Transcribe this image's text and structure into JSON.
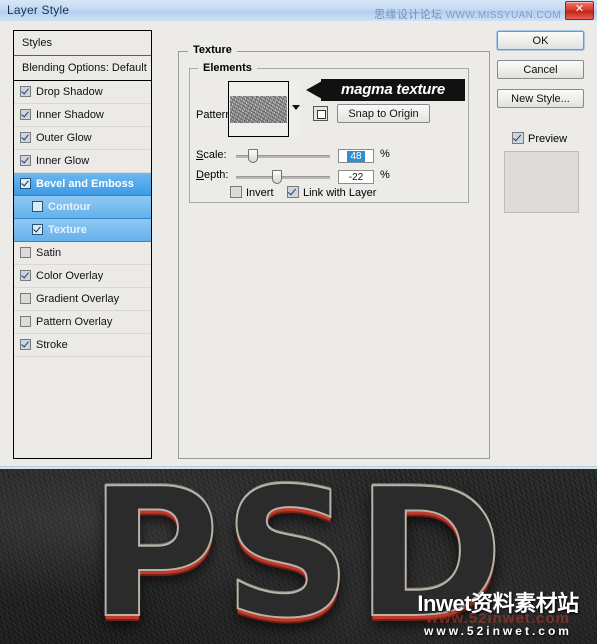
{
  "window": {
    "title": "Layer Style",
    "close_label": "✕",
    "watermark_cn": "思缘设计论坛",
    "watermark_url": "WWW.MISSYUAN.COM"
  },
  "sidebar": {
    "header": "Styles",
    "blending_options": "Blending Options: Default",
    "items": [
      {
        "label": "Drop Shadow",
        "checked": true,
        "sub": false,
        "selected": false
      },
      {
        "label": "Inner Shadow",
        "checked": true,
        "sub": false,
        "selected": false
      },
      {
        "label": "Outer Glow",
        "checked": true,
        "sub": false,
        "selected": false
      },
      {
        "label": "Inner Glow",
        "checked": true,
        "sub": false,
        "selected": false
      },
      {
        "label": "Bevel and Emboss",
        "checked": true,
        "sub": false,
        "selected": true
      },
      {
        "label": "Contour",
        "checked": false,
        "sub": true,
        "selected": true
      },
      {
        "label": "Texture",
        "checked": true,
        "sub": true,
        "selected": true
      },
      {
        "label": "Satin",
        "checked": false,
        "sub": false,
        "selected": false
      },
      {
        "label": "Color Overlay",
        "checked": true,
        "sub": false,
        "selected": false
      },
      {
        "label": "Gradient Overlay",
        "checked": false,
        "sub": false,
        "selected": false
      },
      {
        "label": "Pattern Overlay",
        "checked": false,
        "sub": false,
        "selected": false
      },
      {
        "label": "Stroke",
        "checked": true,
        "sub": false,
        "selected": false
      }
    ]
  },
  "texture": {
    "panel_title": "Texture",
    "elements_title": "Elements",
    "pattern_label": "Pattern:",
    "snap_to_origin_label": "Snap to Origin",
    "annotation": "magma texture",
    "scale_label": "Scale:",
    "scale_value": "48",
    "scale_unit": "%",
    "depth_label": "Depth:",
    "depth_value": "-22",
    "depth_unit": "%",
    "invert_label": "Invert",
    "invert_checked": false,
    "link_with_layer_label": "Link with Layer",
    "link_with_layer_checked": true
  },
  "buttons": {
    "ok": "OK",
    "cancel": "Cancel",
    "new_style": "New Style...",
    "preview": "Preview",
    "preview_checked": true
  },
  "artwork": {
    "text": "PSD",
    "watermark_main": "Inwet资料素材站",
    "watermark_ghost": "www.52inwet.com",
    "watermark_url": "www.52inwet.com"
  },
  "colors": {
    "selection_blue": "#3d9ae6",
    "dialog_bg": "#ecebe7",
    "titlebar_blue": "#c3daf2",
    "close_red": "#c02414",
    "accent_red": "#c0392b"
  }
}
